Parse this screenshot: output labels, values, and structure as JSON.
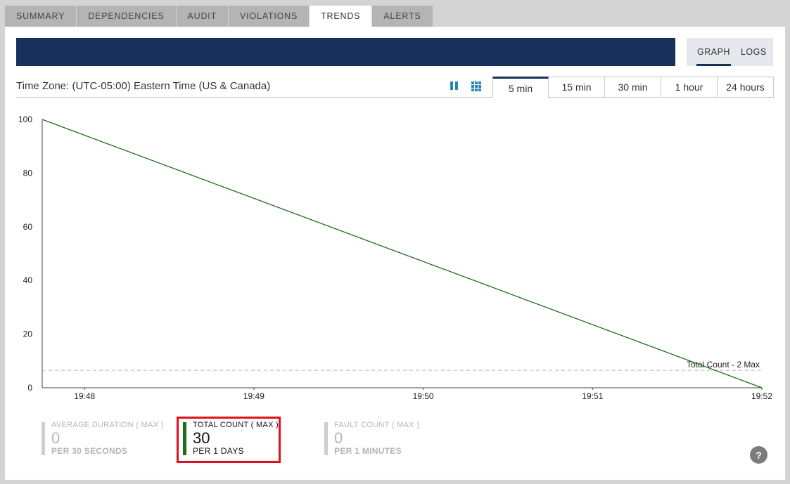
{
  "tabs": [
    {
      "label": "SUMMARY",
      "active": false
    },
    {
      "label": "DEPENDENCIES",
      "active": false
    },
    {
      "label": "AUDIT",
      "active": false
    },
    {
      "label": "VIOLATIONS",
      "active": false
    },
    {
      "label": "TRENDS",
      "active": true
    },
    {
      "label": "ALERTS",
      "active": false
    }
  ],
  "view_toggle": {
    "graph_label": "GRAPH",
    "logs_label": "LOGS",
    "active": "GRAPH"
  },
  "timezone_label": "Time Zone: (UTC-05:00) Eastern Time (US & Canada)",
  "icons": {
    "pause": "pause-icon",
    "grid": "grid-icon",
    "help": "help-icon"
  },
  "ranges": [
    {
      "label": "5 min",
      "active": true
    },
    {
      "label": "15 min",
      "active": false
    },
    {
      "label": "30 min",
      "active": false
    },
    {
      "label": "1 hour",
      "active": false
    },
    {
      "label": "24 hours",
      "active": false
    }
  ],
  "chart_data": {
    "type": "line",
    "x": [
      "19:47:45",
      "19:52:00"
    ],
    "xticks": [
      "19:48",
      "19:49",
      "19:50",
      "19:51",
      "19:52"
    ],
    "ylim": [
      0,
      100
    ],
    "yticks": [
      0,
      20,
      40,
      60,
      80,
      100
    ],
    "series": [
      {
        "values": [
          100,
          0
        ],
        "color": "#1a6e1a"
      }
    ],
    "threshold": {
      "label": "Total Count - 2 Max",
      "value": 6.5
    },
    "grid": false
  },
  "stats": [
    {
      "label": "AVERAGE DURATION ( MAX )",
      "value": "0",
      "per": "PER 30 SECONDS",
      "highlighted": false
    },
    {
      "label": "TOTAL COUNT ( MAX )",
      "value": "30",
      "per": "PER 1 DAYS",
      "highlighted": true
    },
    {
      "label": "FAULT COUNT ( MAX )",
      "value": "0",
      "per": "PER 1 MINUTES",
      "highlighted": false
    }
  ],
  "help_glyph": "?",
  "colors": {
    "banner": "#17305c",
    "accent": "#2a86b8",
    "highlight": "#e0101a",
    "series": "#1a6e1a"
  }
}
